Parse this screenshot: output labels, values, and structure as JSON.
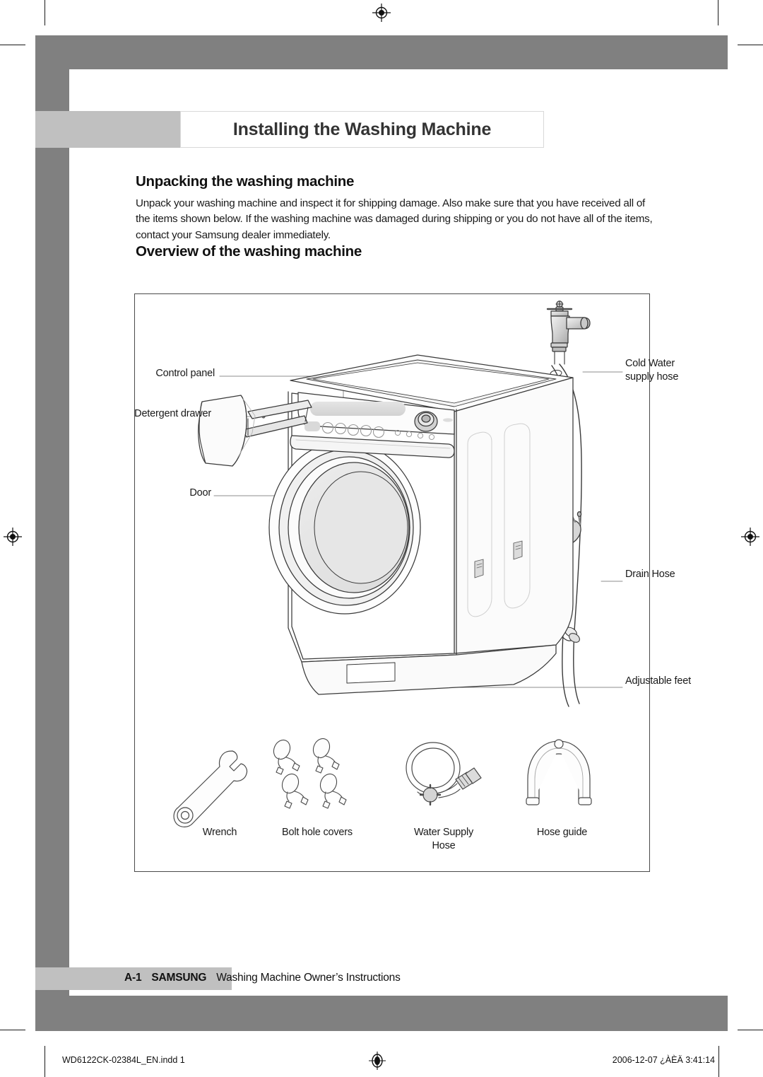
{
  "page": {
    "chapter_title": "Installing the Washing Machine"
  },
  "sections": [
    {
      "heading": "Unpacking the washing machine",
      "body": "Unpack your washing machine and inspect it for shipping damage. Also make sure that you have received all of the items shown below. If the washing machine was damaged during shipping or you do not have all of the items, contact your Samsung dealer immediately."
    },
    {
      "heading": "Overview of the washing machine"
    }
  ],
  "diagram": {
    "callouts_left": [
      {
        "label": "Control panel"
      },
      {
        "label": "Detergent drawer"
      },
      {
        "label": "Door"
      }
    ],
    "callouts_right": [
      {
        "label": "Cold Water\nsupply hose"
      },
      {
        "label": "Drain Hose"
      },
      {
        "label": "Adjustable feet"
      }
    ],
    "accessories": [
      {
        "label": "Wrench",
        "icon": "wrench-icon"
      },
      {
        "label": "Bolt hole covers",
        "icon": "bolt-hole-cover-icon"
      },
      {
        "label": "Water Supply\nHose",
        "icon": "water-supply-hose-icon"
      },
      {
        "label": "Hose guide",
        "icon": "hose-guide-icon"
      }
    ]
  },
  "footer": {
    "page_number": "A-1",
    "brand": "SAMSUNG",
    "subtitle": "Washing Machine Owner’s Instructions"
  },
  "print_slug": {
    "file_name": "WD6122CK-02384L_EN.indd   1",
    "timestamp": "2006-12-07   ¿ÀÈÄ 3:41:14",
    "mark": "registration-target-icon"
  },
  "colors": {
    "frame_dark_gray": "#808080",
    "frame_light_gray": "#c0c0c0",
    "title_text": "#333333",
    "body_text": "#1a1a1a",
    "box_border": "#4a4a4a"
  }
}
